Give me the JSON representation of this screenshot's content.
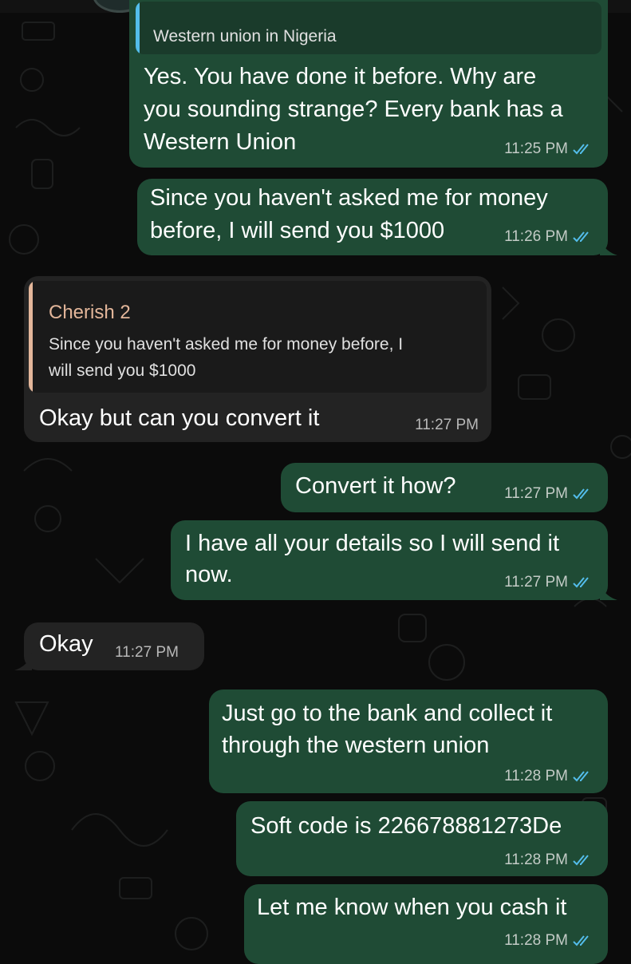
{
  "chat": {
    "messages": [
      {
        "direction": "outgoing",
        "quote_text": "Western union in Nigeria",
        "lines": [
          "Yes. You have done it before. Why are",
          "you sounding strange? Every bank has a",
          "Western Union"
        ],
        "time": "11:25 PM",
        "status_icon": "double-check-read-icon"
      },
      {
        "direction": "outgoing",
        "lines": [
          "Since  you haven't asked me for money",
          "before, I will send you $1000"
        ],
        "time": "11:26 PM",
        "status_icon": "double-check-read-icon"
      },
      {
        "direction": "incoming",
        "quote_author": "Cherish 2",
        "quote_lines": [
          "Since  you haven't asked me for money before, I",
          "will send you $1000"
        ],
        "lines": [
          "Okay but can you convert it"
        ],
        "time": "11:27 PM"
      },
      {
        "direction": "outgoing",
        "lines": [
          "Convert it how?"
        ],
        "time": "11:27 PM",
        "status_icon": "double-check-read-icon"
      },
      {
        "direction": "outgoing",
        "lines": [
          "I have all your details so I will send it",
          "now."
        ],
        "time": "11:27 PM",
        "status_icon": "double-check-read-icon"
      },
      {
        "direction": "incoming",
        "lines": [
          "Okay"
        ],
        "time": "11:27 PM"
      },
      {
        "direction": "outgoing",
        "lines": [
          "Just go to the bank and collect it",
          "through the western union"
        ],
        "time": "11:28 PM",
        "status_icon": "double-check-read-icon"
      },
      {
        "direction": "outgoing",
        "lines": [
          "Soft code is 226678881273De"
        ],
        "time": "11:28 PM",
        "status_icon": "double-check-read-icon"
      },
      {
        "direction": "outgoing",
        "lines": [
          "Let me know when you cash it"
        ],
        "time": "11:28 PM",
        "status_icon": "double-check-read-icon"
      }
    ]
  },
  "colors": {
    "background": "#0b0b0b",
    "outgoing_bubble": "#1f4b35",
    "incoming_bubble": "#232323",
    "quote_outgoing_bg": "#1a3b2b",
    "quote_incoming_bg": "#1a1a1a",
    "quote_accent_outgoing": "#53bdeb",
    "quote_accent_incoming": "#e3b69a",
    "read_ticks": "#53bdeb"
  }
}
